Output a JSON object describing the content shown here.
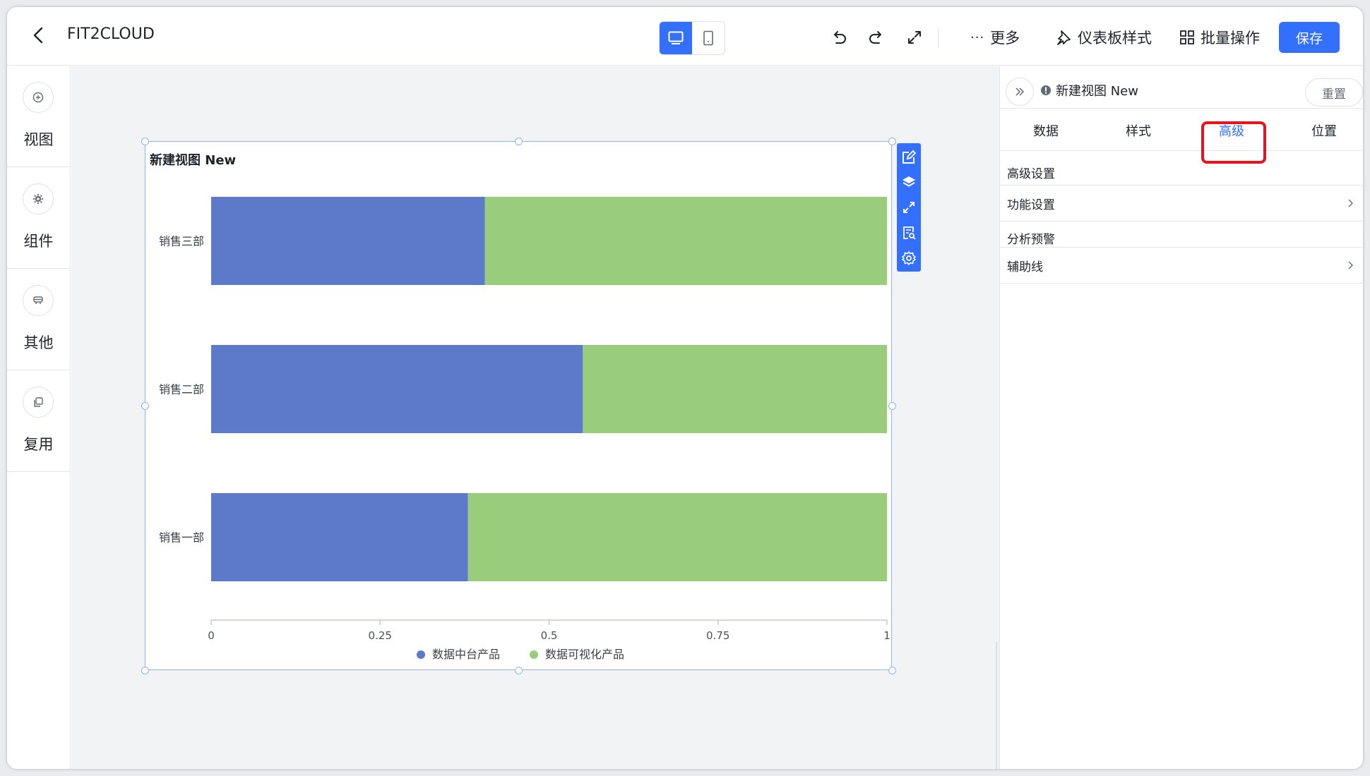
{
  "header": {
    "app_title": "FIT2CLOUD",
    "more_label": "更多",
    "dashboard_style_label": "仪表板样式",
    "batch_label": "批量操作",
    "save_label": "保存"
  },
  "sidebar": {
    "items": [
      {
        "label": "视图",
        "icon": "plus-circle-icon"
      },
      {
        "label": "组件",
        "icon": "gear-icon"
      },
      {
        "label": "其他",
        "icon": "widget-icon"
      },
      {
        "label": "复用",
        "icon": "copy-icon"
      }
    ]
  },
  "chart": {
    "title": "新建视图 New"
  },
  "chart_data": {
    "type": "bar",
    "orientation": "horizontal",
    "stacked": true,
    "percent": true,
    "categories": [
      "销售三部",
      "销售二部",
      "销售一部"
    ],
    "series": [
      {
        "name": "数据中台产品",
        "values": [
          0.405,
          0.55,
          0.38
        ],
        "color": "#5d79c9"
      },
      {
        "name": "数据可视化产品",
        "values": [
          0.595,
          0.45,
          0.62
        ],
        "color": "#9acd7b"
      }
    ],
    "xlim": [
      0,
      1
    ],
    "xticks": [
      "0",
      "0.25",
      "0.5",
      "0.75",
      "1"
    ],
    "legend": "bottom",
    "grid": false
  },
  "right_panel": {
    "title": "新建视图 New",
    "reset_label": "重置",
    "tabs": [
      "数据",
      "样式",
      "高级",
      "位置"
    ],
    "active_tab": "高级",
    "sections": [
      {
        "title": "高级设置",
        "row": "功能设置"
      },
      {
        "title": "分析预警",
        "row": "辅助线"
      }
    ]
  },
  "colors": {
    "accent": "#3370ff",
    "highlight": "#e8141c"
  }
}
